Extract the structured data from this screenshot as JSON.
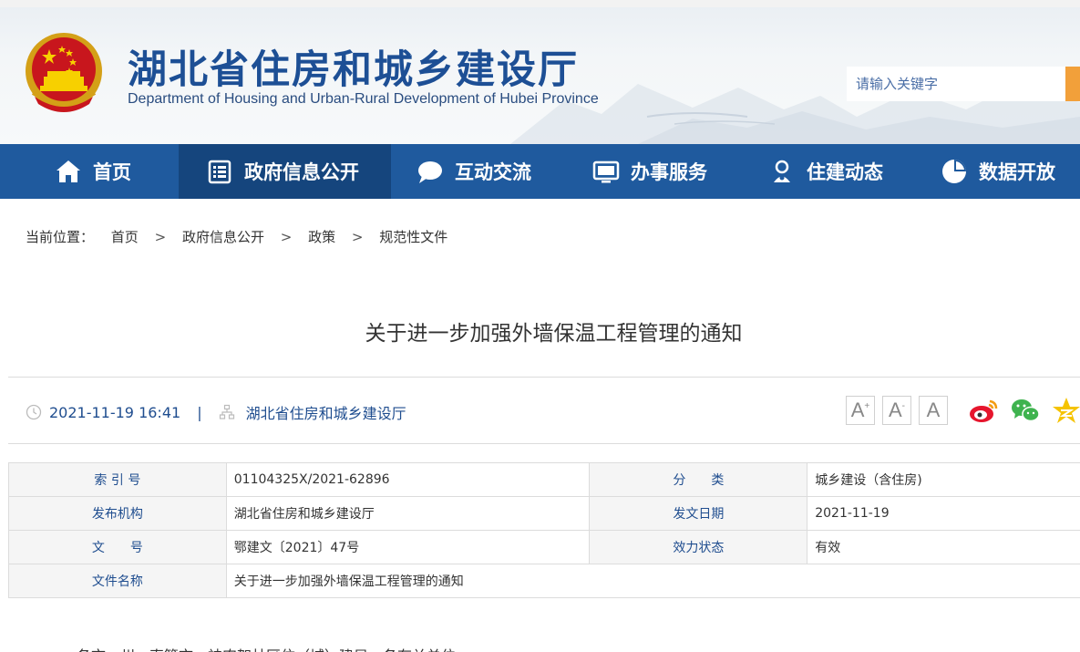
{
  "header": {
    "title": "湖北省住房和城乡建设厅",
    "subtitle": "Department of Housing and Urban-Rural Development of Hubei Province",
    "search_placeholder": "请输入关键字"
  },
  "nav": {
    "items": [
      {
        "label": "首页",
        "icon": "home-icon"
      },
      {
        "label": "政府信息公开",
        "icon": "document-list-icon"
      },
      {
        "label": "互动交流",
        "icon": "chat-bubble-icon"
      },
      {
        "label": "办事服务",
        "icon": "monitor-icon"
      },
      {
        "label": "住建动态",
        "icon": "person-badge-icon"
      },
      {
        "label": "数据开放",
        "icon": "pie-chart-icon"
      }
    ],
    "active_index": 1
  },
  "breadcrumb": {
    "prefix": "当前位置：",
    "items": [
      "首页",
      "政府信息公开",
      "政策",
      "规范性文件"
    ],
    "separator": ">"
  },
  "article": {
    "title": "关于进一步加强外墙保温工程管理的通知",
    "datetime": "2021-11-19 16:41",
    "pipe": "|",
    "publisher": "湖北省住房和城乡建设厅",
    "body_start": "各市、州、直管市、神农架林区住（城）建局，各有关单位："
  },
  "tools": {
    "font_large": "A",
    "font_medium": "A",
    "font_small": "A",
    "font_large_sup": "+",
    "font_medium_sup": "-",
    "share_targets": [
      "weibo-icon",
      "wechat-icon",
      "qzone-icon"
    ]
  },
  "info_table": {
    "rows": [
      [
        {
          "label": "索 引 号",
          "value": "01104325X/2021-62896"
        },
        {
          "label": "分　　类",
          "value": "城乡建设（含住房)"
        }
      ],
      [
        {
          "label": "发布机构",
          "value": "湖北省住房和城乡建设厅"
        },
        {
          "label": "发文日期",
          "value": "2021-11-19"
        }
      ],
      [
        {
          "label": "文　　号",
          "value": "鄂建文〔2021〕47号"
        },
        {
          "label": "效力状态",
          "value": "有效"
        }
      ],
      [
        {
          "label": "文件名称",
          "value": "关于进一步加强外墙保温工程管理的通知"
        }
      ]
    ]
  },
  "colors": {
    "brand_blue": "#1f5a9e",
    "nav_active": "#15457d",
    "title_blue": "#1d4f95",
    "label_blue": "#1f4d8f",
    "search_button": "#f2a03a"
  }
}
